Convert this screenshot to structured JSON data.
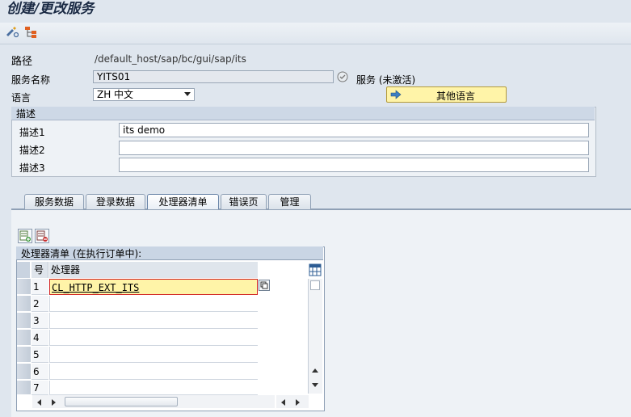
{
  "title": "创建/更改服务",
  "toolbar": {
    "icons": [
      "display-change-icon",
      "hierarchy-icon"
    ]
  },
  "form": {
    "path_label": "路径",
    "path_value": "/default_host/sap/bc/gui/sap/its",
    "service_name_label": "服务名称",
    "service_name_value": "YITS01",
    "service_status": "服务 (未激活)",
    "language_label": "语言",
    "language_value": "ZH 中文",
    "other_languages_button": "其他语言"
  },
  "description": {
    "header": "描述",
    "rows": [
      {
        "label": "描述1",
        "value": "its demo"
      },
      {
        "label": "描述2",
        "value": ""
      },
      {
        "label": "描述3",
        "value": ""
      }
    ]
  },
  "tabs": [
    {
      "label": "服务数据",
      "active": false
    },
    {
      "label": "登录数据",
      "active": false
    },
    {
      "label": "处理器清单",
      "active": true
    },
    {
      "label": "错误页",
      "active": false
    },
    {
      "label": "管理",
      "active": false
    }
  ],
  "handler_table": {
    "title": "处理器清单 (在执行订单中):",
    "columns": [
      "号",
      "处理器"
    ],
    "rows": [
      {
        "num": "1",
        "handler": "CL_HTTP_EXT_ITS"
      },
      {
        "num": "2",
        "handler": ""
      },
      {
        "num": "3",
        "handler": ""
      },
      {
        "num": "4",
        "handler": ""
      },
      {
        "num": "5",
        "handler": ""
      },
      {
        "num": "6",
        "handler": ""
      },
      {
        "num": "7",
        "handler": ""
      }
    ]
  },
  "colors": {
    "background": "#dfe6ee",
    "button_yellow": "#fff4a8",
    "focus_red": "#d02020"
  }
}
